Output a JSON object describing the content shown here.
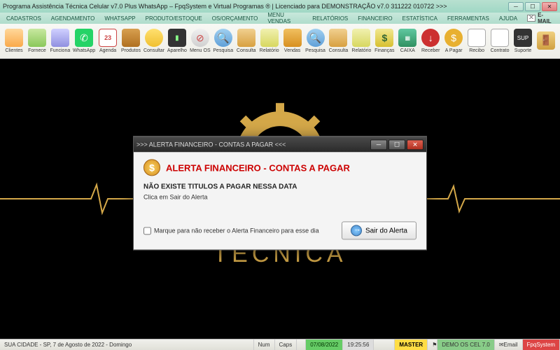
{
  "window": {
    "title": "Programa Assistência Técnica Celular v7.0 Plus WhatsApp – FpqSystem e Virtual Programas ® | Licenciado para  DEMONSTRAÇÃO v7.0 311222 010722 >>>"
  },
  "menu": {
    "items": [
      "CADASTROS",
      "AGENDAMENTO",
      "WHATSAPP",
      "PRODUTO/ESTOQUE",
      "OS/ORÇAMENTO",
      "MENU VENDAS",
      "RELATÓRIOS",
      "FINANCEIRO",
      "ESTATÍSTICA",
      "FERRAMENTAS",
      "AJUDA"
    ],
    "email": "E-MAIL"
  },
  "toolbar": {
    "items": [
      {
        "label": "Clientes",
        "icon": "ic-clientes",
        "name": "clientes"
      },
      {
        "label": "Fornece",
        "icon": "ic-fornece",
        "name": "fornecedores"
      },
      {
        "label": "Funciona",
        "icon": "ic-funciona",
        "name": "funcionarios"
      },
      {
        "label": "WhatsApp",
        "icon": "ic-whatsapp",
        "name": "whatsapp",
        "glyph": "✆"
      },
      {
        "label": "Agenda",
        "icon": "ic-agenda",
        "name": "agenda",
        "glyph": "23"
      },
      {
        "label": "Produtos",
        "icon": "ic-produtos",
        "name": "produtos"
      },
      {
        "label": "Consultar",
        "icon": "ic-consultar",
        "name": "consultar-produtos"
      },
      {
        "label": "Aparelho",
        "icon": "ic-aparelho",
        "name": "aparelho",
        "glyph": "▮"
      },
      {
        "label": "Menu OS",
        "icon": "ic-menuos",
        "name": "menu-os",
        "glyph": "⊘"
      },
      {
        "label": "Pesquisa",
        "icon": "ic-pesquisa",
        "name": "pesquisa-os",
        "glyph": "🔍"
      },
      {
        "label": "Consulta",
        "icon": "ic-consulta",
        "name": "consulta-os"
      },
      {
        "label": "Relatório",
        "icon": "ic-relatorio",
        "name": "relatorio-os"
      },
      {
        "label": "Vendas",
        "icon": "ic-vendas",
        "name": "vendas"
      },
      {
        "label": "Pesquisa",
        "icon": "ic-pesquisa",
        "name": "pesquisa-vendas",
        "glyph": "🔍"
      },
      {
        "label": "Consulta",
        "icon": "ic-consulta",
        "name": "consulta-vendas"
      },
      {
        "label": "Relatório",
        "icon": "ic-relatorio",
        "name": "relatorio-vendas"
      },
      {
        "label": "Finanças",
        "icon": "ic-financas",
        "name": "financas",
        "glyph": "$"
      },
      {
        "label": "CAIXA",
        "icon": "ic-caixa",
        "name": "caixa",
        "glyph": "▦"
      },
      {
        "label": "Receber",
        "icon": "ic-receber",
        "name": "receber",
        "glyph": "↓"
      },
      {
        "label": "A Pagar",
        "icon": "ic-apagar",
        "name": "a-pagar",
        "glyph": "$"
      },
      {
        "label": "Recibo",
        "icon": "ic-recibo",
        "name": "recibo"
      },
      {
        "label": "Contrato",
        "icon": "ic-contrato",
        "name": "contrato"
      },
      {
        "label": "Suporte",
        "icon": "ic-suporte",
        "name": "suporte",
        "glyph": "SUP"
      },
      {
        "label": "",
        "icon": "ic-sair",
        "name": "sair",
        "glyph": "🚪"
      }
    ]
  },
  "brand": {
    "text": "ASSISTÊNCIA TÉCNICA"
  },
  "dialog": {
    "title": ">>> ALERTA FINANCEIRO - CONTAS A PAGAR <<<",
    "heading": "ALERTA FINANCEIRO - CONTAS A PAGAR",
    "message": "NÃO EXISTE TITULOS A PAGAR NESSA DATA",
    "sub": "Clica em Sair do Alerta",
    "checkbox": "Marque para não receber o Alerta Financeiro para esse dia",
    "exit": "Sair do Alerta"
  },
  "status": {
    "location": "SUA CIDADE - SP, 7 de Agosto de 2022 - Domingo",
    "num": "Num",
    "caps": "Caps",
    "date": "07/08/2022",
    "time": "19:25:56",
    "master": "MASTER",
    "demo": "DEMO OS CEL 7.0",
    "email": "Email",
    "brand": "FpqSystem"
  }
}
